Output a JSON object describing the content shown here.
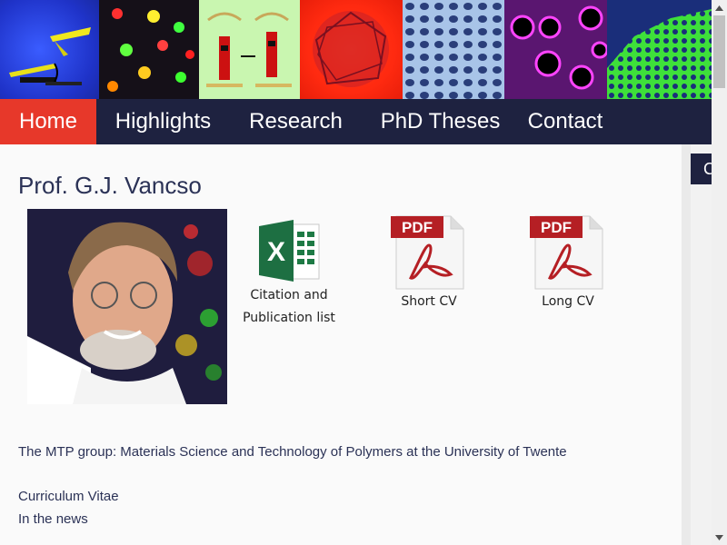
{
  "nav": {
    "items": [
      {
        "label": "Home",
        "active": true
      },
      {
        "label": "Highlights"
      },
      {
        "label": "Research"
      },
      {
        "label": "PhD Theses"
      },
      {
        "label": "Contact"
      }
    ]
  },
  "main": {
    "title": "Prof. G.J. Vancso",
    "documents": [
      {
        "label_line1": "Citation and",
        "label_line2": "Publication list",
        "icon": "excel-icon"
      },
      {
        "label": "Short CV",
        "icon": "pdf-icon"
      },
      {
        "label": "Long CV",
        "icon": "pdf-icon"
      }
    ],
    "intro": "The MTP group: Materials Science and Technology of Polymers at the University of Twente",
    "links": [
      "Curriculum Vitae",
      "In the news"
    ]
  },
  "sidebar": {
    "tab_label": "C"
  },
  "colors": {
    "nav_bg": "#1e2240",
    "nav_active": "#e7382a",
    "title_text": "#2b3256"
  }
}
